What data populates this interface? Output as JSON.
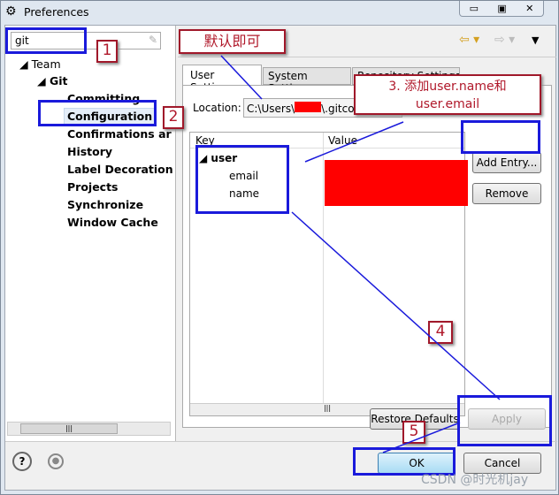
{
  "window": {
    "title": "Preferences"
  },
  "filter": {
    "value": "git"
  },
  "tree": {
    "team": "Team",
    "git": "Git",
    "items": [
      "Committing",
      "Configuration",
      "Confirmations ar",
      "History",
      "Label Decoration",
      "Projects",
      "Synchronize",
      "Window Cache"
    ]
  },
  "tabs": [
    "User Settings",
    "System Settings",
    "Repository Settings"
  ],
  "location": {
    "label": "Location:",
    "value_prefix": "C:\\Users\\",
    "value_suffix": "\\.gitco"
  },
  "table": {
    "headers": [
      "Key",
      "Value"
    ],
    "section": "user",
    "rows": [
      "email",
      "name"
    ]
  },
  "buttons": {
    "add_entry": "Add Entry...",
    "remove": "Remove",
    "restore_defaults": "Restore Defaults",
    "apply": "Apply",
    "ok": "OK",
    "cancel": "Cancel"
  },
  "annotations": {
    "n1": "1",
    "n2": "2",
    "n4": "4",
    "n5": "5",
    "default": "默认即可",
    "step3": "3. 添加user.name和user.email"
  },
  "watermark": "CSDN @时光机jay",
  "colors": {
    "annotation_blue": "#1a1adb",
    "annotation_red": "#a0182a",
    "redaction": "#ff0000"
  }
}
